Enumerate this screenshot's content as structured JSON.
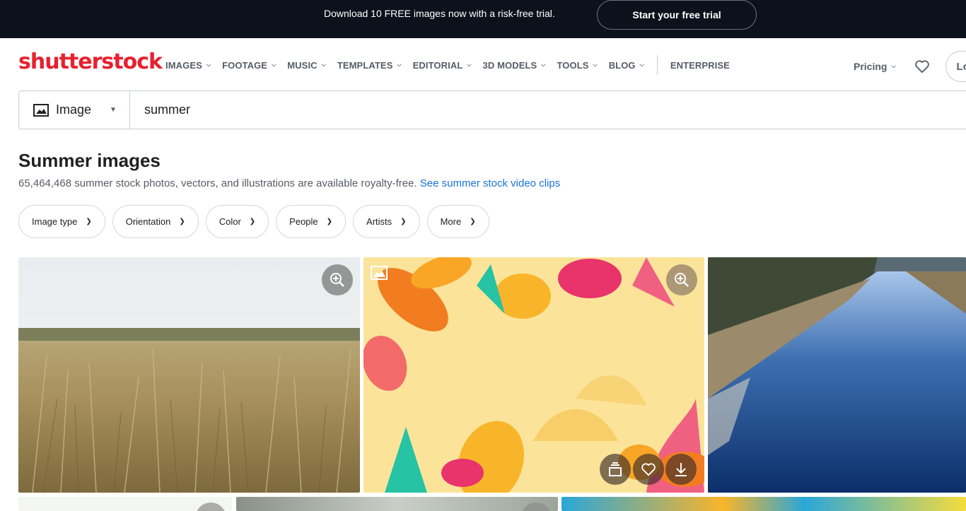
{
  "promo": {
    "text": "Download 10 FREE images now with a risk-free trial.",
    "cta": "Start your free trial"
  },
  "nav": {
    "logo": "shutterstock",
    "items": [
      "IMAGES",
      "FOOTAGE",
      "MUSIC",
      "TEMPLATES",
      "EDITORIAL",
      "3D MODELS",
      "TOOLS",
      "BLOG"
    ],
    "enterprise": "ENTERPRISE",
    "pricing": "Pricing",
    "login": "Lo"
  },
  "search": {
    "type": "Image",
    "query": "summer"
  },
  "results": {
    "title": "Summer images",
    "subtitle": "65,464,468 summer stock photos, vectors, and illustrations are available royalty-free.",
    "link": "See summer stock video clips"
  },
  "filters": [
    "Image type",
    "Orientation",
    "Color",
    "People",
    "Artists",
    "More"
  ],
  "colors": {
    "brand_red": "#e8202e",
    "promo_bg": "#0c121c",
    "link_blue": "#1a73d9"
  },
  "images": [
    {
      "name": "wheat-field-photo",
      "icons": [
        "zoom-icon"
      ]
    },
    {
      "name": "tropical-leaves-vector",
      "icons": [
        "image-type-icon",
        "zoom-icon",
        "collection-icon",
        "heart-icon",
        "download-icon"
      ]
    },
    {
      "name": "river-landscape-photo",
      "icons": []
    }
  ]
}
